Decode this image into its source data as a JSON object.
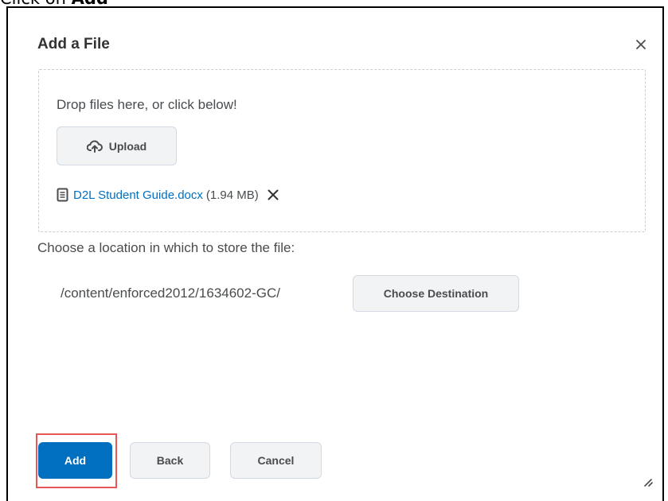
{
  "instruction": {
    "prefix": "Click on",
    "target": "Add"
  },
  "dialog": {
    "title": "Add a File",
    "close_icon": "close-icon"
  },
  "dropzone": {
    "prompt": "Drop files here, or click below!",
    "upload_label": "Upload",
    "upload_icon": "cloud-upload-icon"
  },
  "file": {
    "icon": "document-icon",
    "name": "D2L Student Guide.docx",
    "size": "(1.94 MB)",
    "remove_icon": "close-icon"
  },
  "location": {
    "label": "Choose a location in which to store the file:",
    "path": "/content/enforced2012/1634602-GC/",
    "choose_label": "Choose Destination"
  },
  "footer": {
    "add_label": "Add",
    "back_label": "Back",
    "cancel_label": "Cancel"
  },
  "colors": {
    "primary": "#006fbf",
    "highlight": "#e55656",
    "link": "#006fbf"
  }
}
